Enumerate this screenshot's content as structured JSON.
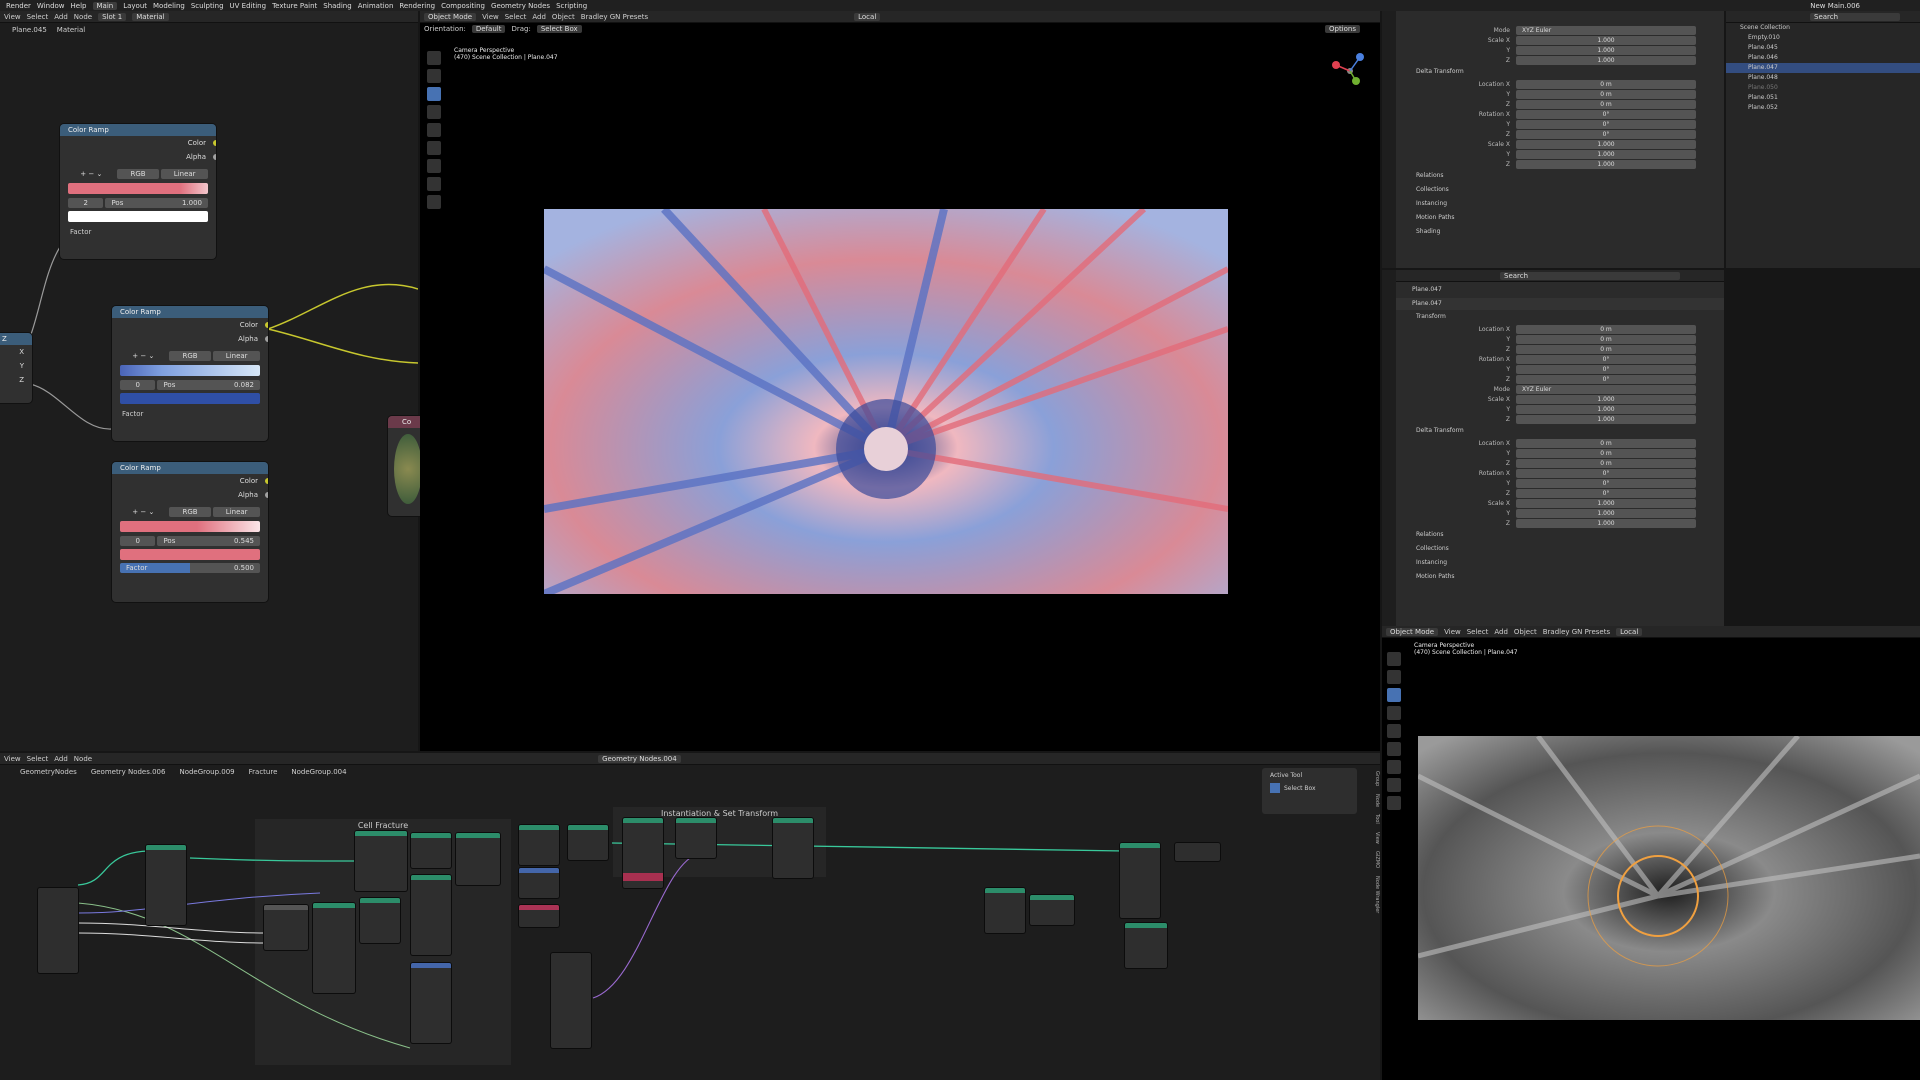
{
  "topbar": {
    "menus": [
      "Render",
      "Window",
      "Help"
    ],
    "workspaces": [
      "Main",
      "Layout",
      "Modeling",
      "Sculpting",
      "UV Editing",
      "Texture Paint",
      "Shading",
      "Animation",
      "Rendering",
      "Compositing",
      "Geometry Nodes",
      "Scripting"
    ],
    "scene": "New Main.006"
  },
  "shader_editor": {
    "header_items": [
      "View",
      "Select",
      "Add",
      "Node"
    ],
    "slot": "Slot 1",
    "material_label": "Material",
    "breadcrumb": [
      "Plane.045",
      "Material"
    ],
    "nodes": [
      {
        "title": "Color Ramp",
        "out1": "Color",
        "out2": "Alpha",
        "mode": "RGB",
        "interp": "Linear",
        "index": "2",
        "pos_label": "Pos",
        "pos": "1.000",
        "factor": "Factor"
      },
      {
        "title": "Color Ramp",
        "out1": "Color",
        "out2": "Alpha",
        "mode": "RGB",
        "interp": "Linear",
        "index": "0",
        "pos_label": "Pos",
        "pos": "0.082",
        "factor": "Factor"
      },
      {
        "title": "Color Ramp",
        "out1": "Color",
        "out2": "Alpha",
        "mode": "RGB",
        "interp": "Linear",
        "index": "0",
        "pos_label": "Pos",
        "pos": "0.545",
        "factor": "Factor",
        "factor_value": "0.500"
      }
    ],
    "xyz": [
      "X",
      "Y",
      "Z"
    ],
    "partial_z": "Z",
    "partial_node": "Co"
  },
  "viewport": {
    "mode": "Object Mode",
    "menus": [
      "View",
      "Select",
      "Add",
      "Object"
    ],
    "presets": "Bradley GN Presets",
    "transform": "Local",
    "orientation_label": "Orientation:",
    "orientation": "Default",
    "drag_label": "Drag:",
    "drag": "Select Box",
    "options": "Options",
    "camera": "Camera Perspective",
    "collection": "(470) Scene Collection | Plane.047"
  },
  "properties_top": {
    "mode_label": "Mode",
    "mode": "XYZ Euler",
    "scale": [
      {
        "l": "Scale X",
        "v": "1.000"
      },
      {
        "l": "Y",
        "v": "1.000"
      },
      {
        "l": "Z",
        "v": "1.000"
      }
    ],
    "delta_title": "Delta Transform",
    "delta": [
      {
        "l": "Location X",
        "v": "0 m"
      },
      {
        "l": "Y",
        "v": "0 m"
      },
      {
        "l": "Z",
        "v": "0 m"
      },
      {
        "l": "Rotation X",
        "v": "0°"
      },
      {
        "l": "Y",
        "v": "0°"
      },
      {
        "l": "Z",
        "v": "0°"
      },
      {
        "l": "Scale X",
        "v": "1.000"
      },
      {
        "l": "Y",
        "v": "1.000"
      },
      {
        "l": "Z",
        "v": "1.000"
      }
    ],
    "sections": [
      "Relations",
      "Collections",
      "Instancing",
      "Motion Paths",
      "Shading"
    ]
  },
  "properties_bottom": {
    "search": "Search",
    "object": "Plane.047",
    "object_data": "Plane.047",
    "transform_title": "Transform",
    "transform": [
      {
        "l": "Location X",
        "v": "0 m"
      },
      {
        "l": "Y",
        "v": "0 m"
      },
      {
        "l": "Z",
        "v": "0 m"
      },
      {
        "l": "Rotation X",
        "v": "0°"
      },
      {
        "l": "Y",
        "v": "0°"
      },
      {
        "l": "Z",
        "v": "0°"
      }
    ],
    "mode_label": "Mode",
    "mode": "XYZ Euler",
    "scale": [
      {
        "l": "Scale X",
        "v": "1.000"
      },
      {
        "l": "Y",
        "v": "1.000"
      },
      {
        "l": "Z",
        "v": "1.000"
      }
    ],
    "delta_title": "Delta Transform",
    "delta": [
      {
        "l": "Location X",
        "v": "0 m"
      },
      {
        "l": "Y",
        "v": "0 m"
      },
      {
        "l": "Z",
        "v": "0 m"
      },
      {
        "l": "Rotation X",
        "v": "0°"
      },
      {
        "l": "Y",
        "v": "0°"
      },
      {
        "l": "Z",
        "v": "0°"
      },
      {
        "l": "Scale X",
        "v": "1.000"
      },
      {
        "l": "Y",
        "v": "1.000"
      },
      {
        "l": "Z",
        "v": "1.000"
      }
    ],
    "sections": [
      "Relations",
      "Collections",
      "Instancing",
      "Motion Paths"
    ]
  },
  "outliner": {
    "search": "Search",
    "root": "Scene Collection",
    "items": [
      "Empty.010",
      "Plane.045",
      "Plane.046",
      "Plane.047",
      "Plane.048",
      "Plane.050",
      "Plane.051",
      "Plane.052"
    ],
    "selected_index": 3
  },
  "geo_editor": {
    "menus": [
      "View",
      "Select",
      "Add",
      "Node"
    ],
    "tree": "Geometry Nodes.004",
    "breadcrumb": [
      "GeometryNodes",
      "Geometry Nodes.006",
      "NodeGroup.009",
      "Fracture",
      "NodeGroup.004"
    ],
    "frame1": "Cell Fracture",
    "frame2": "Instantiation & Set Transform",
    "active_tool_title": "Active Tool",
    "active_tool": "Select Box",
    "side_tabs": [
      "Group",
      "Node",
      "Tool",
      "View",
      "GIZMO",
      "Node Wrangler"
    ]
  },
  "viewport2": {
    "mode": "Object Mode",
    "menus": [
      "View",
      "Select",
      "Add",
      "Object"
    ],
    "presets": "Bradley GN Presets",
    "transform": "Local",
    "camera": "Camera Perspective",
    "collection": "(470) Scene Collection | Plane.047"
  },
  "colors": {
    "accent": "#4772b3",
    "ramp_pink": "#e0707e",
    "ramp_blue": "#4a64b8",
    "node_green": "#2c8d6a",
    "socket_yellow": "#c7c72e"
  }
}
